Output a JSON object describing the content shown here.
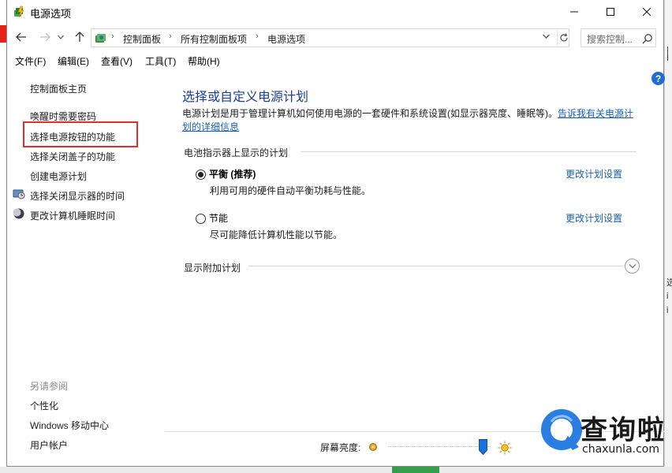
{
  "window": {
    "title": "电源选项",
    "controls": {
      "minimize": "minimize",
      "maximize": "maximize",
      "close": "close"
    }
  },
  "address_bar": {
    "breadcrumbs": [
      "控制面板",
      "所有控制面板项",
      "电源选项"
    ],
    "search_placeholder": "搜索控制..."
  },
  "menu": [
    "文件(F)",
    "编辑(E)",
    "查看(V)",
    "工具(T)",
    "帮助(H)"
  ],
  "sidebar": {
    "home": "控制面板主页",
    "links": [
      {
        "label": "唤醒时需要密码",
        "icon": null
      },
      {
        "label": "选择电源按钮的功能",
        "icon": null,
        "highlighted": true
      },
      {
        "label": "选择关闭盖子的功能",
        "icon": null
      },
      {
        "label": "创建电源计划",
        "icon": null
      },
      {
        "label": "选择关闭显示器的时间",
        "icon": "display-icon"
      },
      {
        "label": "更改计算机睡眠时间",
        "icon": "moon-icon"
      }
    ],
    "see_also_title": "另请参阅",
    "see_also": [
      "个性化",
      "Windows 移动中心",
      "用户帐户"
    ]
  },
  "main": {
    "title": "选择或自定义电源计划",
    "description": "电源计划是用于管理计算机如何使用电源的一套硬件和系统设置(如显示器亮度、睡眠等)。",
    "description_link_line1": "告诉我有关电源计",
    "description_link_line2": "划的详细信息",
    "group_label": "电池指示器上显示的计划",
    "plans": [
      {
        "name": "平衡 (推荐)",
        "description": "利用可用的硬件自动平衡功耗与性能。",
        "selected": true,
        "link": "更改计划设置"
      },
      {
        "name": "节能",
        "description": "尽可能降低计算机性能以节能。",
        "selected": false,
        "link": "更改计划设置"
      }
    ],
    "extra_plans_label": "显示附加计划"
  },
  "footer": {
    "brightness_label": "屏幕亮度:",
    "brightness_level": 0.93
  },
  "watermark": {
    "text": "查询啦",
    "url": "chaxunla.com"
  },
  "colors": {
    "title_blue": "#1d3d8f",
    "link_blue": "#1a5fb4",
    "highlight_red": "#e0302c",
    "help_blue": "#1f6fd1"
  }
}
